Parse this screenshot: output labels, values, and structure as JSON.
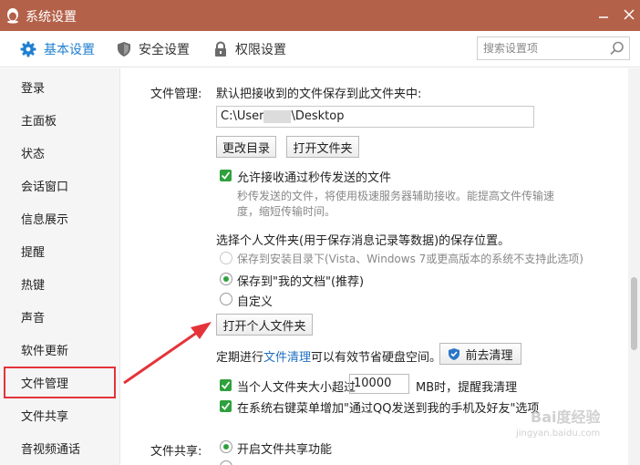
{
  "window": {
    "title": "系统设置"
  },
  "tabs": [
    {
      "label": "基本设置",
      "icon": "gear-icon",
      "active": true
    },
    {
      "label": "安全设置",
      "icon": "shield-icon",
      "active": false
    },
    {
      "label": "权限设置",
      "icon": "lock-icon",
      "active": false
    }
  ],
  "search": {
    "placeholder": "搜索设置项"
  },
  "sidebar": {
    "items": [
      "登录",
      "主面板",
      "状态",
      "会话窗口",
      "信息展示",
      "提醒",
      "热键",
      "声音",
      "软件更新",
      "文件管理",
      "文件共享",
      "音视频通话"
    ],
    "selected": "文件管理"
  },
  "file_management": {
    "section_label": "文件管理:",
    "save_prompt": "默认把接收到的文件保存到此文件夹中:",
    "path_prefix": "C:\\User",
    "path_suffix": "\\Desktop",
    "change_dir_button": "更改目录",
    "open_folder_button": "打开文件夹",
    "allow_flash_transfer": "允许接收通过秒传发送的文件",
    "flash_desc_line1": "秒传发送的文件，将使用极速服务器辅助接收。能提高文件传输速",
    "flash_desc_line2": "度，缩短传输时间。",
    "personal_folder_prompt": "选择个人文件夹(用于保存消息记录等数据)的保存位置。",
    "radio_install_dir": "保存到安装目录下(Vista、Windows 7或更高版本的系统不支持此选项)",
    "radio_my_docs": "保存到\"我的文档\"(推荐)",
    "radio_custom": "自定义",
    "open_personal_button": "打开个人文件夹",
    "cleanup_prefix": "定期进行",
    "cleanup_link": "文件清理",
    "cleanup_suffix": "可以有效节省硬盘空间。",
    "cleanup_button": "前去清理",
    "size_warn_prefix": "当个人文件夹大小超过",
    "size_value": "10000",
    "size_warn_suffix": "MB时，提醒我清理",
    "context_menu_option": "在系统右键菜单增加\"通过QQ发送到我的手机及好友\"选项"
  },
  "file_sharing": {
    "section_label": "文件共享:",
    "enable_sharing": "开启文件共享功能"
  },
  "watermark": {
    "brand": "Bai度经验",
    "url": "jingyan.baidu.com"
  },
  "colors": {
    "titlebar": "#b4614a",
    "accent": "#1f7fd0",
    "check": "#2fa13c",
    "highlight": "#e4343a"
  }
}
